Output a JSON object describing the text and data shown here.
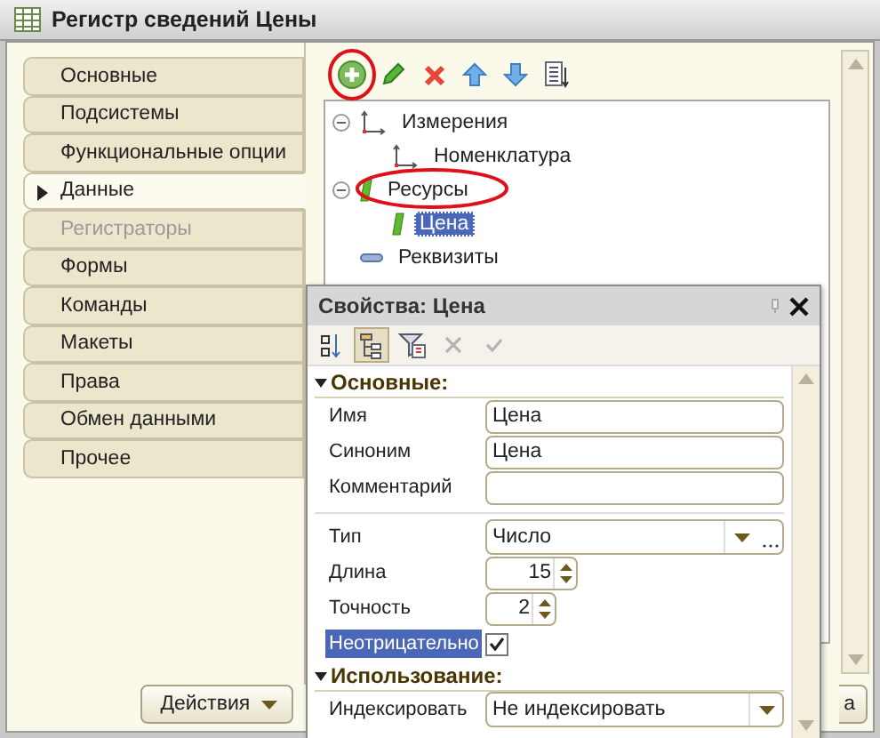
{
  "window": {
    "title": "Регистр сведений Цены"
  },
  "sections": [
    {
      "label": "Основные",
      "selected": false,
      "disabled": false
    },
    {
      "label": "Подсистемы",
      "selected": false,
      "disabled": false
    },
    {
      "label": "Функциональные опции",
      "selected": false,
      "disabled": false
    },
    {
      "label": "Данные",
      "selected": true,
      "disabled": false
    },
    {
      "label": "Регистраторы",
      "selected": false,
      "disabled": true
    },
    {
      "label": "Формы",
      "selected": false,
      "disabled": false
    },
    {
      "label": "Команды",
      "selected": false,
      "disabled": false
    },
    {
      "label": "Макеты",
      "selected": false,
      "disabled": false
    },
    {
      "label": "Права",
      "selected": false,
      "disabled": false
    },
    {
      "label": "Обмен данными",
      "selected": false,
      "disabled": false
    },
    {
      "label": "Прочее",
      "selected": false,
      "disabled": false
    }
  ],
  "toolbar": [
    {
      "kind": "add",
      "highlighted": true
    },
    {
      "kind": "edit",
      "highlighted": false
    },
    {
      "kind": "delete",
      "highlighted": false
    },
    {
      "kind": "up",
      "highlighted": false
    },
    {
      "kind": "down",
      "highlighted": false
    },
    {
      "kind": "list",
      "highlighted": false
    }
  ],
  "tree": [
    {
      "label": "Измерения",
      "kind": "dimension",
      "highlighted": false,
      "selected": false,
      "children": [
        {
          "label": "Номенклатура",
          "kind": "dimension",
          "highlighted": false,
          "selected": false
        }
      ]
    },
    {
      "label": "Ресурсы",
      "kind": "resource",
      "highlighted": true,
      "selected": false,
      "children": [
        {
          "label": "Цена",
          "kind": "resource",
          "highlighted": false,
          "selected": true
        }
      ]
    },
    {
      "label": "Реквизиты",
      "kind": "attribute",
      "highlighted": false,
      "selected": false
    }
  ],
  "buttons": [
    {
      "label": "Действия",
      "kind": "menu"
    },
    {
      "label": "а",
      "kind": "plain"
    }
  ],
  "properties": {
    "title": "Свойства: Цена",
    "toolbar": [
      {
        "kind": "sort",
        "pressed": false,
        "disabled": false
      },
      {
        "kind": "categories",
        "pressed": true,
        "disabled": false
      },
      {
        "kind": "filter",
        "pressed": false,
        "disabled": false
      },
      {
        "kind": "clear",
        "pressed": false,
        "disabled": true
      },
      {
        "kind": "apply",
        "pressed": false,
        "disabled": true
      }
    ],
    "groups": [
      {
        "title": "Основные:",
        "rows": [
          {
            "label": "Имя",
            "kind": "text",
            "value": "Цена",
            "selected": false
          },
          {
            "label": "Синоним",
            "kind": "text",
            "value": "Цена",
            "selected": false
          },
          {
            "label": "Комментарий",
            "kind": "text",
            "selected": false
          },
          {
            "kind": "separator"
          },
          {
            "label": "Тип",
            "kind": "type",
            "value": "Число",
            "selected": false
          },
          {
            "label": "Длина",
            "kind": "spin",
            "value": "15",
            "selected": false
          },
          {
            "label": "Точность",
            "kind": "spin",
            "value": "2",
            "selected": false
          },
          {
            "label": "Неотрицательно",
            "kind": "check",
            "checked": true,
            "selected": true
          }
        ]
      },
      {
        "title": "Использование:",
        "rows": [
          {
            "label": "Индексировать",
            "kind": "select",
            "value": "Не индексировать",
            "selected": false
          }
        ]
      }
    ]
  }
}
